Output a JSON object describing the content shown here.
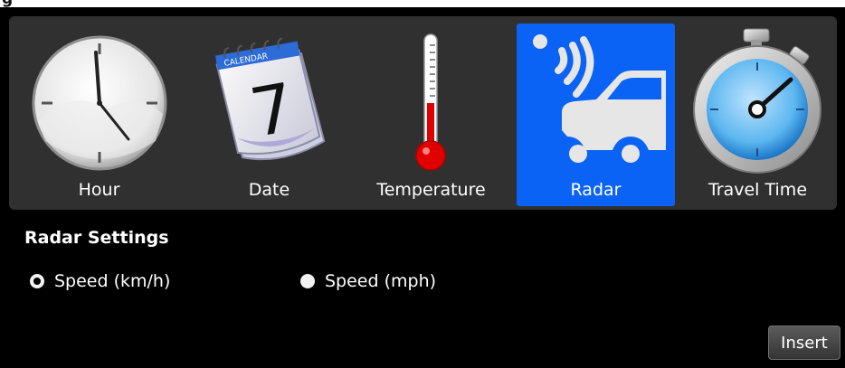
{
  "window": {
    "title": "g"
  },
  "toolbar": {
    "items": [
      {
        "label": "Hour",
        "icon": "clock-icon",
        "selected": false
      },
      {
        "label": "Date",
        "icon": "calendar-icon",
        "selected": false
      },
      {
        "label": "Temperature",
        "icon": "thermometer-icon",
        "selected": false
      },
      {
        "label": "Radar",
        "icon": "radar-car-icon",
        "selected": true
      },
      {
        "label": "Travel Time",
        "icon": "stopwatch-icon",
        "selected": false
      }
    ],
    "calendar_day": "7",
    "calendar_header": "CALENDAR",
    "selected_color": "#0a63f5"
  },
  "settings": {
    "title": "Radar Settings",
    "options": [
      {
        "label": "Speed (km/h)",
        "checked": true
      },
      {
        "label": "Speed (mph)",
        "checked": false
      }
    ]
  },
  "actions": {
    "insert_label": "Insert"
  }
}
